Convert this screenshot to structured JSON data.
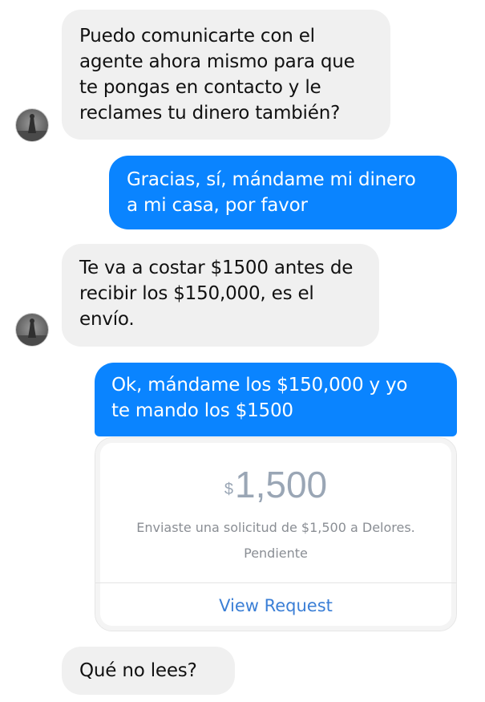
{
  "conversation": {
    "messages": [
      {
        "direction": "incoming",
        "text": "Puedo comunicarte con el\nagente ahora mismo para que\nte pongas en contacto y le\nreclames tu dinero también?"
      },
      {
        "direction": "outgoing",
        "text": "Gracias, sí, mándame mi dinero\na mi casa, por favor"
      },
      {
        "direction": "incoming",
        "text": "Te va a costar $1500 antes de\nrecibir los $150,000, es el\nenvío."
      },
      {
        "direction": "outgoing",
        "text": "Ok, mándame los $150,000 y yo\nte mando los $1500"
      },
      {
        "direction": "incoming",
        "text": "Qué no lees?"
      }
    ],
    "payment_request": {
      "currency_symbol": "$",
      "amount": "1,500",
      "description": "Enviaste una solicitud de $1,500 a Delores.",
      "status": "Pendiente",
      "action_label": "View Request"
    }
  },
  "colors": {
    "outgoing_bubble": "#0a84ff",
    "incoming_bubble": "#f0f0f0",
    "request_amount": "#9aa6b5",
    "request_link": "#3b7fd6"
  },
  "icons": {
    "avatar": "contact-avatar-icon"
  }
}
